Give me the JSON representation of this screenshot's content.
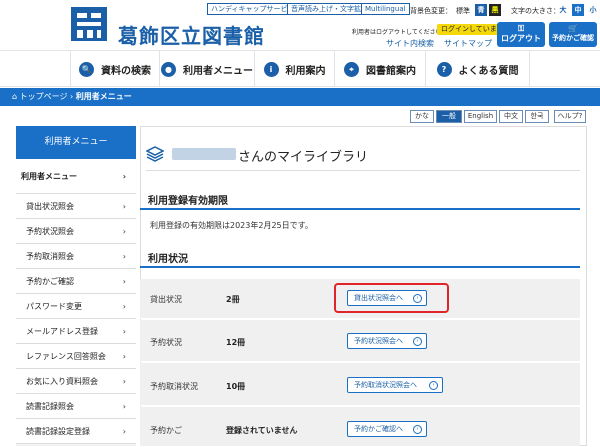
{
  "header": {
    "title": "葛飾区立図書館",
    "top_buttons": [
      "ハンディキャップサービス",
      "音声読み上げ・文字拡大",
      "Multilingual"
    ],
    "bg_label": "背景色変更：",
    "bg_standard": "標準",
    "bg_blue": "青",
    "bg_black": "黒",
    "font_label": "文字の大きさ：",
    "font_large": "大",
    "font_medium": "中",
    "font_small": "小",
    "login_msg": "利用者はログアウトしてください。",
    "login_badge": "ログインしています。",
    "site_search": "サイト内検索",
    "sitemap": "サイトマップ",
    "logout": "ログアウト",
    "cart": "予約かご確認"
  },
  "nav": [
    "資料の検索",
    "利用者メニュー",
    "利用案内",
    "図書館案内",
    "よくある質問"
  ],
  "breadcrumb": {
    "home": "トップページ",
    "current": "利用者メニュー"
  },
  "languages": [
    "かな",
    "一般",
    "English",
    "中文",
    "한국",
    "ヘルプ"
  ],
  "sidebar": {
    "heading": "利用者メニュー",
    "items": [
      "利用者メニュー",
      "貸出状況照会",
      "予約状況照会",
      "予約取消照会",
      "予約かご確認",
      "パスワード変更",
      "メールアドレス登録",
      "レファレンス回答照会",
      "お気に入り資料照会",
      "読書記録照会",
      "読書記録設定登録"
    ]
  },
  "main": {
    "title_suffix": "さんのマイライブラリ",
    "validity_heading": "利用登録有効期限",
    "validity_text": "利用登録の有効期限は2023年2月25日です。",
    "status_heading": "利用状況",
    "rows": [
      {
        "label": "貸出状況",
        "value": "2冊",
        "button": "貸出状況照会へ"
      },
      {
        "label": "予約状況",
        "value": "12冊",
        "button": "予約状況照会へ"
      },
      {
        "label": "予約取消状況",
        "value": "10冊",
        "button": "予約取消状況照会へ"
      },
      {
        "label": "予約かご",
        "value": "登録されていません",
        "button": "予約かご確認へ"
      }
    ]
  },
  "colors": {
    "accent": "#1a6fc7",
    "highlight": "#e0242a"
  }
}
